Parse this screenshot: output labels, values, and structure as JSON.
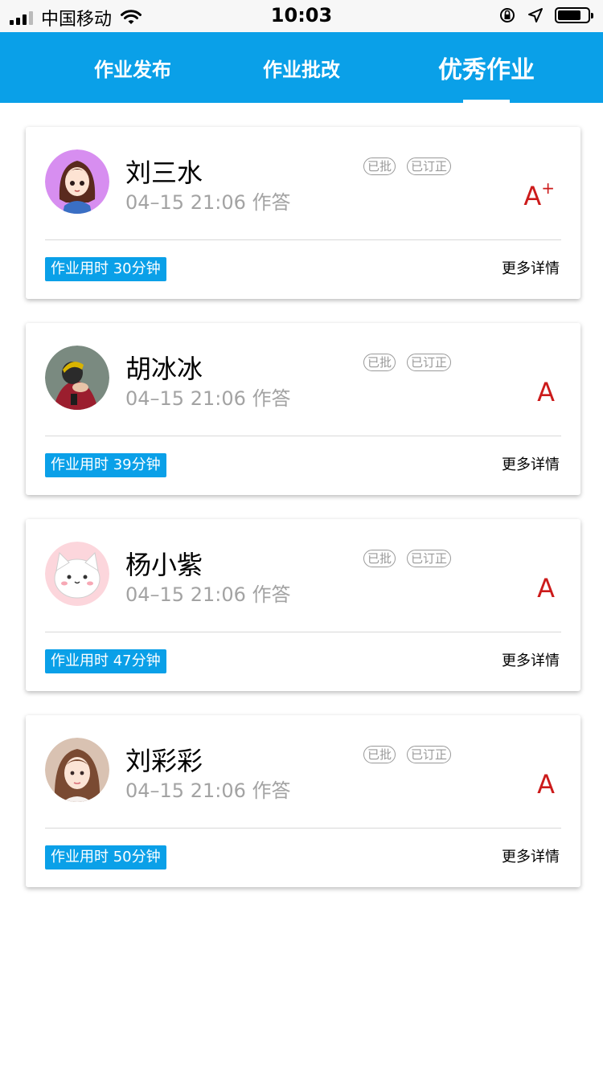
{
  "status_bar": {
    "carrier": "中国移动",
    "time": "10:03"
  },
  "tabs": [
    {
      "label": "作业发布",
      "active": false
    },
    {
      "label": "作业批改",
      "active": false
    },
    {
      "label": "优秀作业",
      "active": true
    }
  ],
  "colors": {
    "primary": "#0aa0e8",
    "grade": "#cc1b1b",
    "muted": "#a3a3a3"
  },
  "cards": [
    {
      "name": "刘三水",
      "time": "04–15 21:06 作答",
      "badges": [
        "已批",
        "已订正"
      ],
      "grade": "A",
      "grade_sup": "+",
      "duration": "作业用时 30分钟",
      "more": "更多详情"
    },
    {
      "name": "胡冰冰",
      "time": "04–15 21:06 作答",
      "badges": [
        "已批",
        "已订正"
      ],
      "grade": "A",
      "grade_sup": "",
      "duration": "作业用时 39分钟",
      "more": "更多详情"
    },
    {
      "name": "杨小紫",
      "time": "04–15 21:06 作答",
      "badges": [
        "已批",
        "已订正"
      ],
      "grade": "A",
      "grade_sup": "",
      "duration": "作业用时 47分钟",
      "more": "更多详情"
    },
    {
      "name": "刘彩彩",
      "time": "04–15 21:06 作答",
      "badges": [
        "已批",
        "已订正"
      ],
      "grade": "A",
      "grade_sup": "",
      "duration": "作业用时 50分钟",
      "more": "更多详情"
    }
  ]
}
